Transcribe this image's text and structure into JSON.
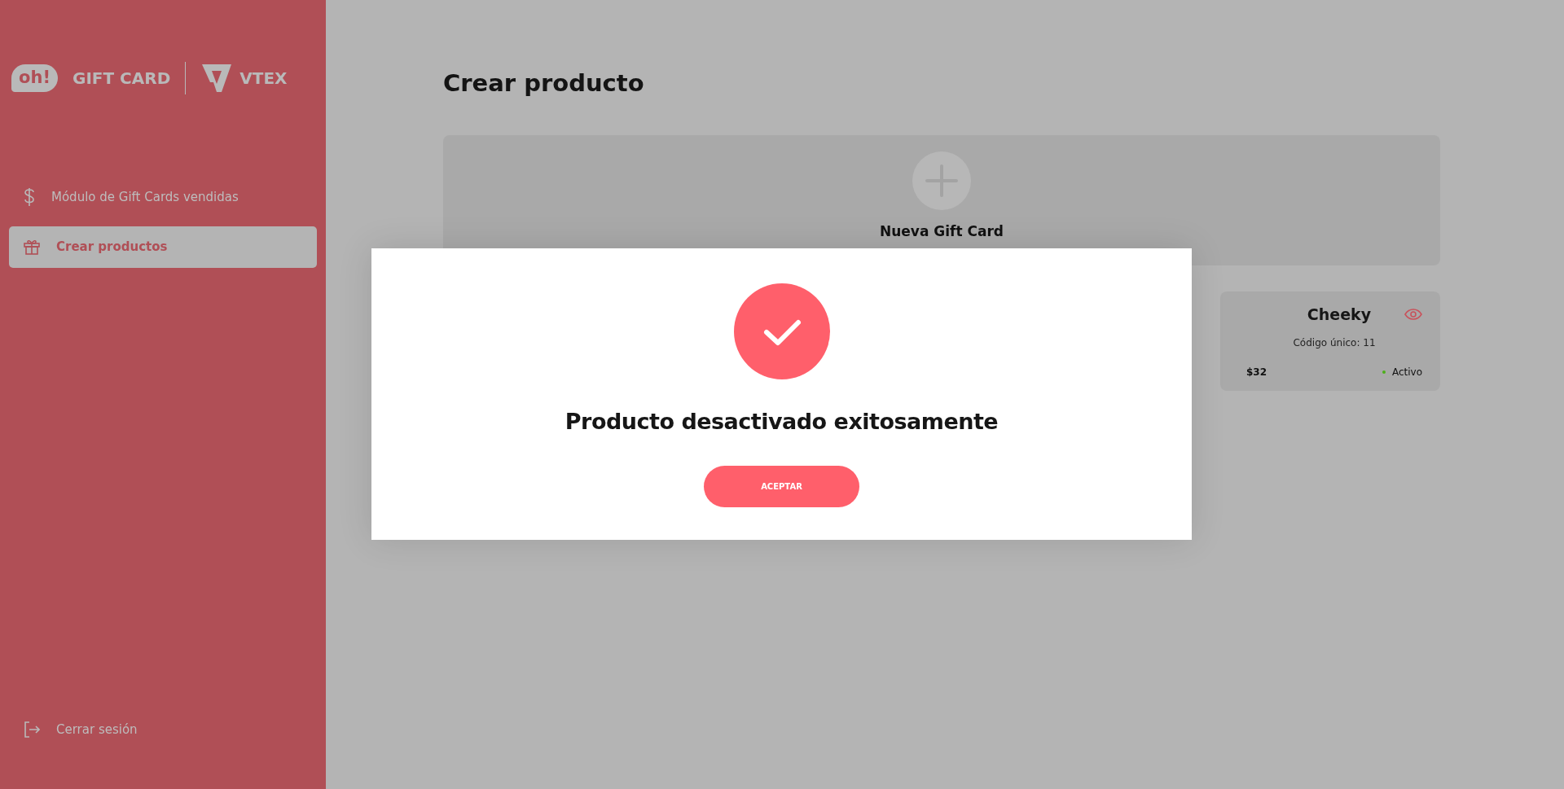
{
  "sidebar": {
    "logo": {
      "badge": "oh!",
      "brand": "GIFT CARD",
      "partner": "VTEX"
    },
    "items": [
      {
        "label": "Módulo de Gift Cards vendidas",
        "selected": false
      },
      {
        "label": "Crear productos",
        "selected": true
      }
    ],
    "logout": {
      "label": "Cerrar sesión"
    }
  },
  "page": {
    "title": "Crear producto",
    "new_card": {
      "label": "Nueva Gift Card"
    },
    "products": [
      {
        "name": "Cheeky",
        "code": "Código único: 11",
        "price": "$32",
        "status": "Activo",
        "color": "#4caf1a"
      }
    ]
  },
  "modal": {
    "title": "Producto desactivado exitosamente",
    "button": "ACEPTAR"
  }
}
